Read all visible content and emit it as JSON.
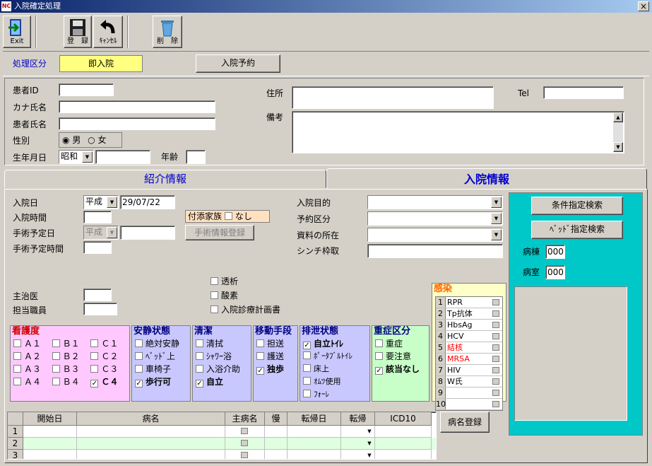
{
  "window": {
    "title": "入院確定処理",
    "app_icon": "NC",
    "close": "×"
  },
  "toolbar": {
    "exit": "Exit",
    "save": "登　録",
    "cancel": "ｷｬﾝｾﾙ",
    "delete": "削　除"
  },
  "category": {
    "label": "処理区分",
    "current": "即入院",
    "reserve_button": "入院予約"
  },
  "patient": {
    "id_label": "患者ID",
    "kana_label": "カナ氏名",
    "name_label": "患者氏名",
    "sex_label": "性別",
    "male": "男",
    "female": "女",
    "birth_label": "生年月日",
    "era": "昭和",
    "age_label": "年齢",
    "address_label": "住所",
    "tel_label": "Tel",
    "note_label": "備考"
  },
  "tabs": {
    "referral": "紹介情報",
    "admission": "入院情報"
  },
  "admission": {
    "date_label": "入院日",
    "date_era": "平成",
    "date_value": "29/07/22",
    "time_label": "入院時間",
    "surgery_date_label": "手術予定日",
    "surgery_era": "平成",
    "surgery_time_label": "手術予定時間",
    "attendant_label": "付添家族",
    "attendant_none": "なし",
    "surgery_info_button": "手術情報登録",
    "purpose_label": "入院目的",
    "reserve_type_label": "予約区分",
    "record_location_label": "資料の所在",
    "scinti_label": "シンチ枠取",
    "dialysis": "透析",
    "oxygen": "酸素",
    "plan": "入院診療計画書",
    "doctor_label": "主治医",
    "staff_label": "担当職員"
  },
  "search": {
    "condition_button": "条件指定検索",
    "bed_button": "ﾍﾞｯﾄﾞ指定検索",
    "ward_label": "病棟",
    "ward_value": "000",
    "room_label": "病室",
    "room_value": "000"
  },
  "nursing": {
    "title": "看護度",
    "items": [
      "Ａ１",
      "Ｂ１",
      "Ｃ１",
      "Ａ２",
      "Ｂ２",
      "Ｃ２",
      "Ａ３",
      "Ｂ３",
      "Ｃ３",
      "Ａ４",
      "Ｂ４",
      "Ｃ４"
    ],
    "checked": "Ｃ４"
  },
  "rest": {
    "title": "安静状態",
    "items": [
      "絶対安静",
      "ﾍﾞｯﾄﾞ上",
      "車椅子",
      "歩行可"
    ]
  },
  "clean": {
    "title": "清潔",
    "items": [
      "清拭",
      "ｼｬﾜｰ浴",
      "入浴介助",
      "自立"
    ]
  },
  "move": {
    "title": "移動手段",
    "items": [
      "担送",
      "護送",
      "独歩"
    ]
  },
  "excretion": {
    "title": "排泄状態",
    "items": [
      "自立ﾄｲﾚ",
      "ﾎﾟｰﾀﾌﾞﾙﾄｲﾚ",
      "床上",
      "ｵﾑﾂ使用",
      "ﾌｫｰﾚ"
    ]
  },
  "severity": {
    "title": "重症区分",
    "items": [
      "重症",
      "要注意",
      "該当なし"
    ]
  },
  "infection": {
    "title": "感染",
    "items": [
      "RPR",
      "Tp抗体",
      "HbsAg",
      "HCV",
      "結核",
      "MRSA",
      "HIV",
      "W氏",
      "",
      ""
    ],
    "nums": [
      "1",
      "2",
      "3",
      "4",
      "5",
      "6",
      "7",
      "8",
      "9",
      "10"
    ]
  },
  "grid": {
    "headers": [
      "開始日",
      "病名",
      "主病名",
      "慢",
      "転帰日",
      "転帰",
      "ICD10"
    ],
    "rows": [
      "1",
      "2",
      "3"
    ]
  },
  "disease_button": "病名登録",
  "colors": {
    "nursing": "#ffc8ff",
    "groups": "#c8c8ff",
    "severity": "#c8ffc8",
    "infection": "#ffffc8",
    "search_panel": "#00c8c8",
    "category_field": "#ffff80"
  }
}
